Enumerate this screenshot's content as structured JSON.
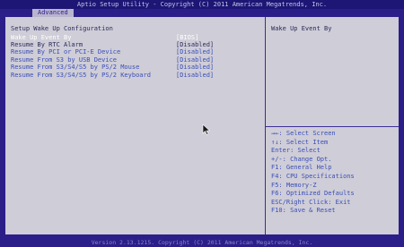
{
  "header": {
    "title": "Aptio Setup Utility - Copyright (C) 2011 American Megatrends, Inc."
  },
  "tabs": [
    {
      "label": "Advanced"
    }
  ],
  "main": {
    "section_title": "Setup Wake Up Configuration",
    "rows": [
      {
        "label": "Wake Up Event By",
        "value": "[BIOS]"
      },
      {
        "label": "Resume By RTC Alarm",
        "value": "[Disabled]"
      },
      {
        "label": "Resume By PCI or PCI-E Device",
        "value": "[Disabled]"
      },
      {
        "label": "Resume From S3 by USB Device",
        "value": "[Disabled]"
      },
      {
        "label": "Resume From S3/S4/S5 by PS/2 Mouse",
        "value": "[Disabled]"
      },
      {
        "label": "Resume From S3/S4/S5 by PS/2 Keyboard",
        "value": "[Disabled]"
      }
    ]
  },
  "help": {
    "text": "Wake Up Event By",
    "keys": [
      "→←: Select Screen",
      "↑↓: Select Item",
      "Enter: Select",
      "+/-: Change Opt.",
      "F1: General Help",
      "F4: CPU Specifications",
      "F5: Memory-Z",
      "F6: Optimized Defaults",
      "ESC/Right Click: Exit",
      "F10: Save & Reset"
    ]
  },
  "footer": {
    "text": "Version 2.13.1215. Copyright (C) 2011 American Megatrends, Inc."
  },
  "icons": {
    "cursor": "mouse-pointer-icon"
  },
  "colors": {
    "background": "#2b1e88",
    "panel": "#cfcdd7",
    "selected_text": "#ffffff",
    "option_text": "#3a4fb8"
  }
}
